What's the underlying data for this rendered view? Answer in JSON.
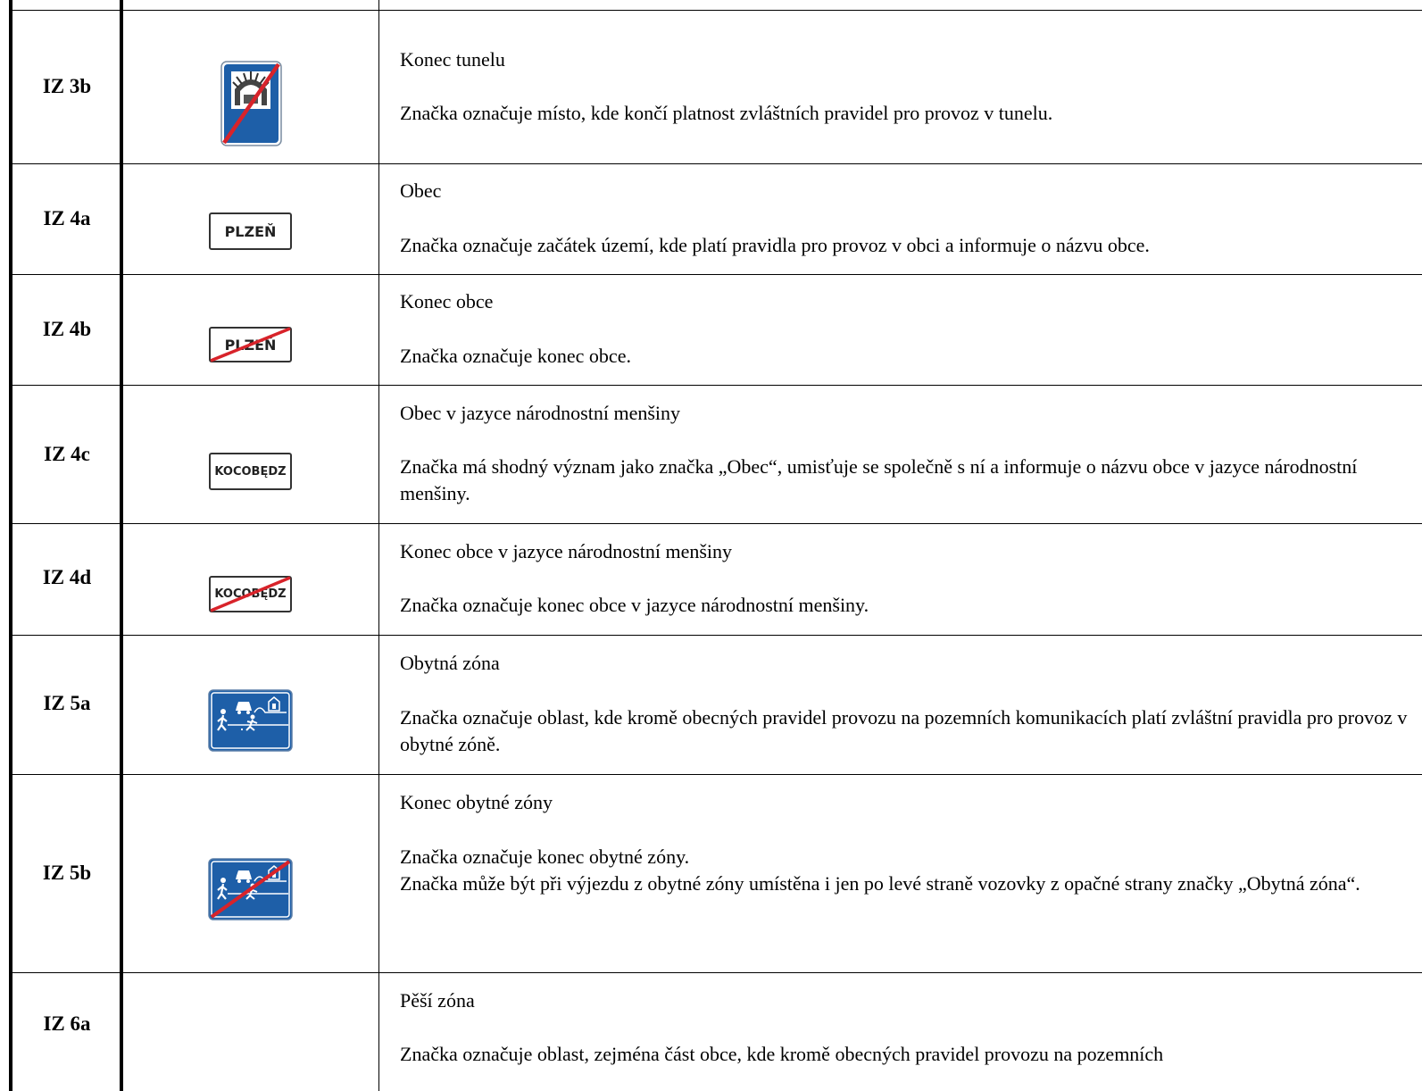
{
  "rows": [
    {
      "code": "IZ 3b",
      "sign_icon": "end-of-tunnel-sign-icon",
      "title": "Konec tunelu",
      "lines": [
        "Značka označuje místo, kde končí platnost zvláštních pravidel pro provoz v tunelu."
      ]
    },
    {
      "code": "IZ 4a",
      "sign_icon": "town-name-sign-icon",
      "sign_text": "PLZEŇ",
      "title": "Obec",
      "lines": [
        "Značka označuje začátek území, kde platí pravidla pro provoz v obci a informuje o názvu obce."
      ]
    },
    {
      "code": "IZ 4b",
      "sign_icon": "end-of-town-sign-icon",
      "sign_text": "PLZEŇ",
      "title": "Konec obce",
      "lines": [
        "Značka označuje konec obce."
      ]
    },
    {
      "code": "IZ 4c",
      "sign_icon": "town-minority-language-sign-icon",
      "sign_text": "KOCOBĘDZ",
      "title": "Obec v jazyce národnostní menšiny",
      "lines": [
        "Značka má shodný význam jako značka „Obec“, umisťuje se společně s ní a informuje o názvu obce v jazyce národnostní menšiny."
      ]
    },
    {
      "code": "IZ 4d",
      "sign_icon": "end-of-town-minority-language-sign-icon",
      "sign_text": "KOCOBĘDZ",
      "title": "Konec obce v jazyce národnostní menšiny",
      "lines": [
        "Značka označuje konec obce v jazyce národnostní menšiny."
      ]
    },
    {
      "code": "IZ 5a",
      "sign_icon": "residential-zone-sign-icon",
      "title": "Obytná zóna",
      "lines": [
        "Značka označuje oblast, kde kromě obecných pravidel provozu na pozemních komunikacích platí zvláštní pravidla pro provoz v obytné zóně."
      ]
    },
    {
      "code": "IZ 5b",
      "sign_icon": "end-of-residential-zone-sign-icon",
      "title": "Konec obytné zóny",
      "lines": [
        "Značka označuje konec obytné zóny.",
        "Značka může být při výjezdu z obytné zóny umístěna i jen po levé straně vozovky z opačné strany značky „Obytná zóna“."
      ]
    },
    {
      "code": "IZ 6a",
      "title": "Pěší zóna",
      "lines": [
        "Značka označuje oblast, zejména část obce, kde kromě obecných pravidel provozu na pozemních"
      ]
    }
  ],
  "colors": {
    "sign_blue": "#1e5fa8",
    "strike_red": "#d8232a"
  }
}
